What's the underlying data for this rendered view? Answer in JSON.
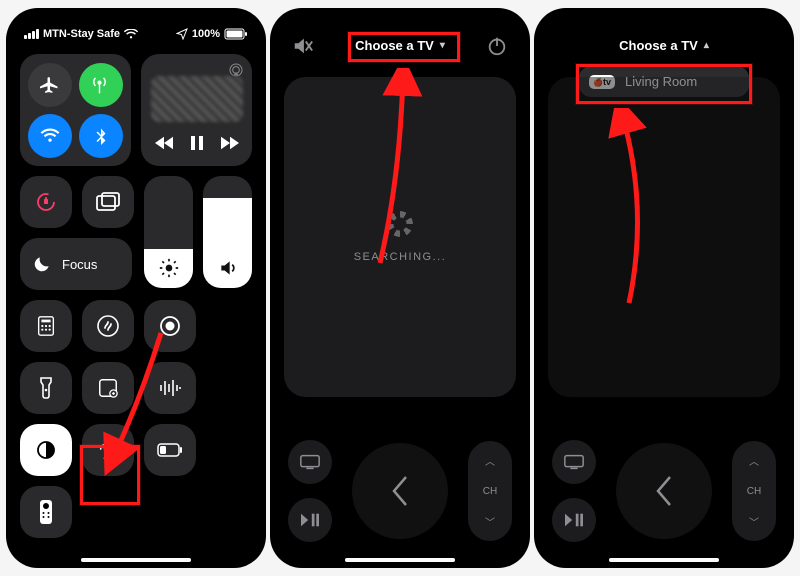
{
  "status": {
    "carrier": "MTN-Stay Safe",
    "battery_pct": "100%"
  },
  "control_center": {
    "focus_label": "Focus",
    "brightness_pct": 35,
    "volume_pct": 80
  },
  "remote": {
    "choose_label": "Choose a TV",
    "searching_label": "SEARCHING...",
    "ch_label": "CH",
    "menu_item": "Living Room",
    "tv_badge": "tv"
  },
  "highlight_color": "#ff1a1a"
}
